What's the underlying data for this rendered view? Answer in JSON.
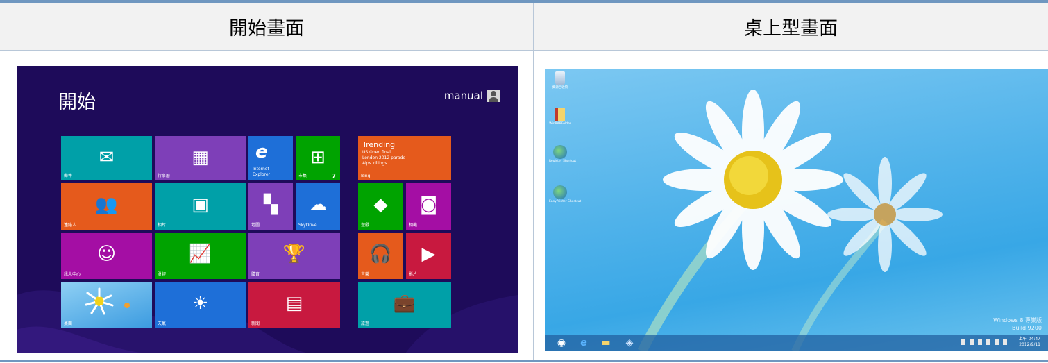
{
  "headers": {
    "left": "開始畫面",
    "right": "桌上型畫面"
  },
  "start_screen": {
    "title": "開始",
    "user_name": "manual",
    "tiles": {
      "mail": {
        "label": "郵件",
        "icon": "mail-icon",
        "color": "#00a0a8"
      },
      "calendar": {
        "label": "行事曆",
        "icon": "calendar-icon",
        "color": "#7e3fb8"
      },
      "ie": {
        "label_line1": "Internet",
        "label_line2": "Explorer",
        "icon": "internet-explorer-icon",
        "color": "#1e6fd8"
      },
      "store": {
        "label": "市集",
        "count": "7",
        "icon": "store-icon",
        "color": "#00a300"
      },
      "people": {
        "label": "連絡人",
        "icon": "people-icon",
        "color": "#e55a1c"
      },
      "photos": {
        "label": "相片",
        "icon": "photos-icon",
        "color": "#00a0a8"
      },
      "maps": {
        "label": "地圖",
        "icon": "maps-icon",
        "color": "#7e3fb8"
      },
      "skydrive": {
        "label": "SkyDrive",
        "icon": "cloud-icon",
        "color": "#1e6fd8"
      },
      "messaging": {
        "label": "訊息中心",
        "icon": "messaging-icon",
        "color": "#a40ea4"
      },
      "finance": {
        "label": "財經",
        "icon": "finance-chart-icon",
        "color": "#00a300"
      },
      "sports": {
        "label": "體育",
        "icon": "trophy-icon",
        "color": "#7e3fb8"
      },
      "desktop": {
        "label": "桌面",
        "icon": "desktop-thumbnail-icon",
        "color": "#2a73c9"
      },
      "weather": {
        "label": "天氣",
        "icon": "sun-icon",
        "color": "#1e6fd8"
      },
      "news": {
        "label": "新聞",
        "icon": "newspaper-icon",
        "color": "#c8193f"
      },
      "trending": {
        "heading": "Trending",
        "lines": [
          "US Open final",
          "London 2012 parade",
          "Alps killings"
        ],
        "label": "Bing",
        "color": "#e55a1c"
      },
      "games": {
        "label": "遊戲",
        "icon": "game-controller-icon",
        "color": "#00a300"
      },
      "camera": {
        "label": "相機",
        "icon": "camera-icon",
        "color": "#a40ea4"
      },
      "music": {
        "label": "音樂",
        "icon": "headphones-icon",
        "color": "#e55a1c"
      },
      "video": {
        "label": "影片",
        "icon": "video-play-icon",
        "color": "#c8193f"
      },
      "travel": {
        "label": "旅遊",
        "icon": "suitcase-icon",
        "color": "#00a0a8"
      }
    }
  },
  "desktop": {
    "icons": [
      "資源回收筒",
      "WinRARFolder",
      "Register Shortcut",
      "EasyPrinter Shortcut"
    ],
    "watermark": {
      "line1": "Windows 8 專業版",
      "line2": "Build 9200"
    },
    "clock": {
      "time": "上午 04:47",
      "date": "2012/9/11"
    },
    "taskbar_icons": [
      "start-orb-icon",
      "internet-explorer-icon",
      "file-explorer-icon",
      "app-icon"
    ]
  }
}
